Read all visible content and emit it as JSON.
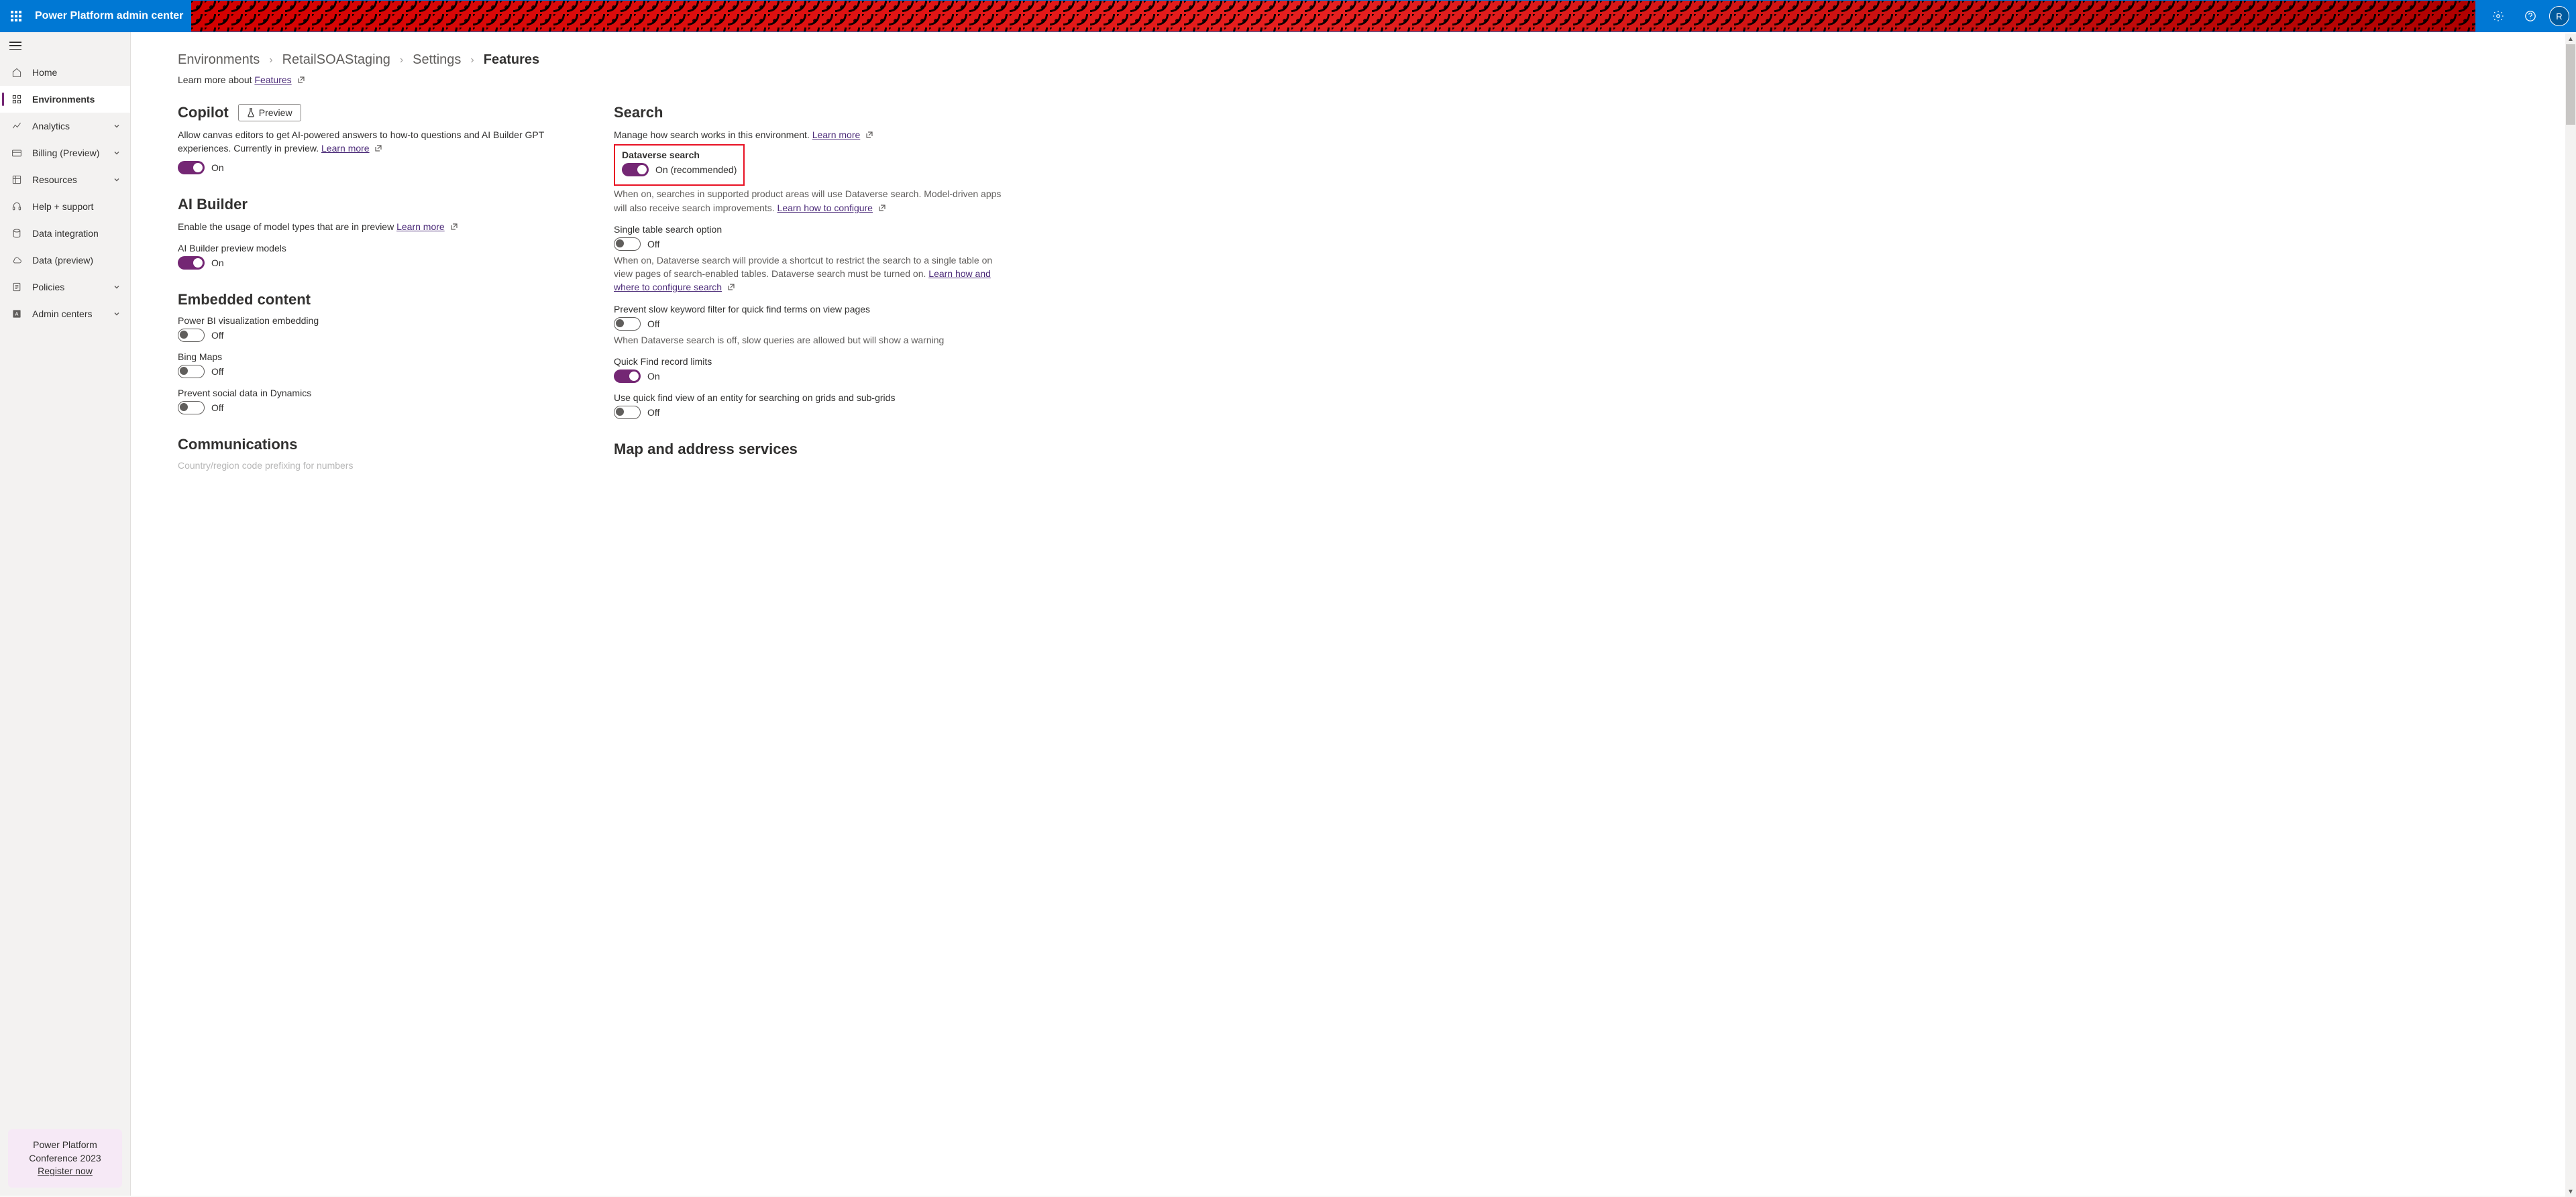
{
  "header": {
    "app_title": "Power Platform admin center",
    "avatar_initial": "R"
  },
  "sidebar": {
    "items": [
      {
        "label": "Home"
      },
      {
        "label": "Environments"
      },
      {
        "label": "Analytics"
      },
      {
        "label": "Billing (Preview)"
      },
      {
        "label": "Resources"
      },
      {
        "label": "Help + support"
      },
      {
        "label": "Data integration"
      },
      {
        "label": "Data (preview)"
      },
      {
        "label": "Policies"
      },
      {
        "label": "Admin centers"
      }
    ],
    "promo": {
      "line1": "Power Platform",
      "line2": "Conference 2023",
      "link": "Register now"
    }
  },
  "breadcrumb": {
    "items": [
      "Environments",
      "RetailSOAStaging",
      "Settings"
    ],
    "current": "Features",
    "learn_prefix": "Learn more about ",
    "learn_link": "Features"
  },
  "left": {
    "copilot": {
      "title": "Copilot",
      "preview_badge": "Preview",
      "desc": "Allow canvas editors to get AI-powered answers to how-to questions and AI Builder GPT experiences. Currently in preview. ",
      "learn": "Learn more",
      "toggle": {
        "state": "On"
      }
    },
    "aibuilder": {
      "title": "AI Builder",
      "desc": "Enable the usage of model types that are in preview ",
      "learn": "Learn more",
      "setting_label": "AI Builder preview models",
      "toggle": {
        "state": "On"
      }
    },
    "embedded": {
      "title": "Embedded content",
      "items": [
        {
          "label": "Power BI visualization embedding",
          "state": "Off"
        },
        {
          "label": "Bing Maps",
          "state": "Off"
        },
        {
          "label": "Prevent social data in Dynamics",
          "state": "Off"
        }
      ]
    },
    "communications": {
      "title": "Communications",
      "cutoff": "Country/region code prefixing for numbers"
    }
  },
  "right": {
    "search": {
      "title": "Search",
      "desc": "Manage how search works in this environment. ",
      "learn": "Learn more",
      "dataverse": {
        "label": "Dataverse search",
        "state": "On (recommended)",
        "sub": "When on, searches in supported product areas will use Dataverse search. Model-driven apps will also receive search improvements. ",
        "sub_link": "Learn how to configure"
      },
      "single_table": {
        "label": "Single table search option",
        "state": "Off",
        "sub": "When on, Dataverse search will provide a shortcut to restrict the search to a single table on view pages of search-enabled tables. Dataverse search must be turned on. ",
        "sub_link": "Learn how and where to configure search"
      },
      "prevent_slow": {
        "label": "Prevent slow keyword filter for quick find terms on view pages",
        "state": "Off",
        "sub": "When Dataverse search is off, slow queries are allowed but will show a warning"
      },
      "quick_find_limits": {
        "label": "Quick Find record limits",
        "state": "On"
      },
      "quick_find_view": {
        "label": "Use quick find view of an entity for searching on grids and sub-grids",
        "state": "Off"
      }
    },
    "map": {
      "title": "Map and address services"
    }
  }
}
